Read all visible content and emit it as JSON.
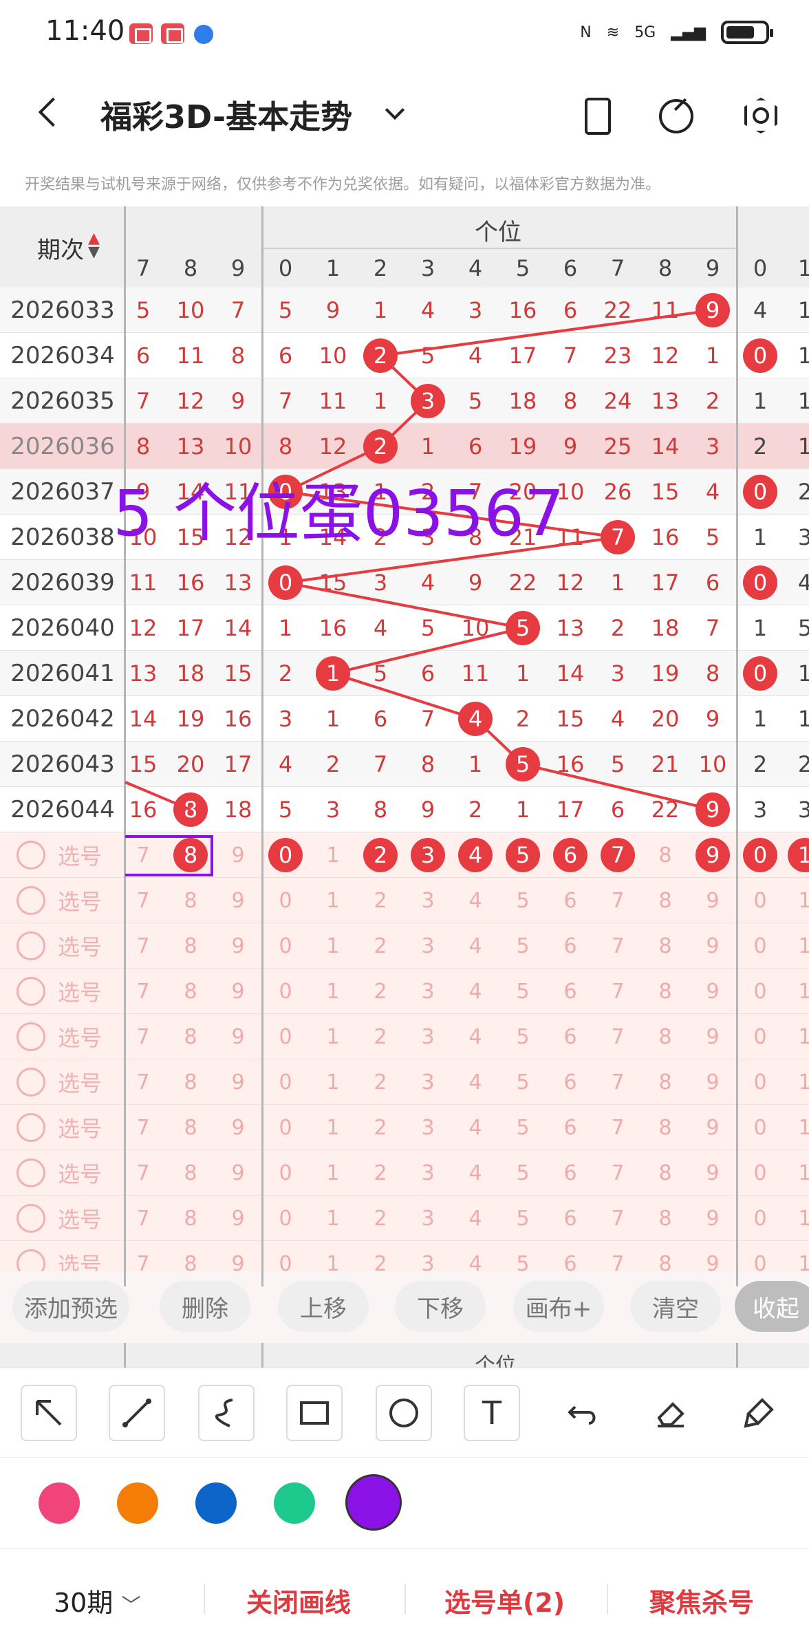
{
  "status_bar": {
    "time": "11:40",
    "net": "5G"
  },
  "header": {
    "title": "福彩3D-基本走势",
    "disclaimer": "开奖结果与试机号来源于网络，仅供参考不作为兑奖依据。如有疑问，以福体彩官方数据为准。"
  },
  "table": {
    "period_header": "期次",
    "group_label": "个位",
    "ten_cols": [
      "7",
      "8",
      "9"
    ],
    "unit_cols": [
      "0",
      "1",
      "2",
      "3",
      "4",
      "5",
      "6",
      "7",
      "8",
      "9"
    ],
    "next_cols": [
      "0",
      "1"
    ],
    "rows": [
      {
        "period": "2026033",
        "ten": [
          "5",
          "10",
          "7"
        ],
        "unit": [
          "5",
          "9",
          "1",
          "4",
          "3",
          "16",
          "6",
          "22",
          "11",
          "9"
        ],
        "hit": 9,
        "next": [
          "4",
          "1"
        ]
      },
      {
        "period": "2026034",
        "ten": [
          "6",
          "11",
          "8"
        ],
        "unit": [
          "6",
          "10",
          "2",
          "5",
          "4",
          "17",
          "7",
          "23",
          "12",
          "1"
        ],
        "hit": 2,
        "next": [
          "0",
          "1"
        ]
      },
      {
        "period": "2026035",
        "ten": [
          "7",
          "12",
          "9"
        ],
        "unit": [
          "7",
          "11",
          "1",
          "3",
          "5",
          "18",
          "8",
          "24",
          "13",
          "2"
        ],
        "hit": 3,
        "next": [
          "1",
          "1"
        ]
      },
      {
        "period": "2026036",
        "ten": [
          "8",
          "13",
          "10"
        ],
        "unit": [
          "8",
          "12",
          "2",
          "1",
          "6",
          "19",
          "9",
          "25",
          "14",
          "3"
        ],
        "hit": 2,
        "next": [
          "2",
          "1"
        ]
      },
      {
        "period": "2026037",
        "ten": [
          "9",
          "14",
          "11"
        ],
        "unit": [
          "0",
          "13",
          "1",
          "2",
          "7",
          "20",
          "10",
          "26",
          "15",
          "4"
        ],
        "hit": 0,
        "next": [
          "0",
          "2"
        ]
      },
      {
        "period": "2026038",
        "ten": [
          "10",
          "15",
          "12"
        ],
        "unit": [
          "1",
          "14",
          "2",
          "3",
          "8",
          "21",
          "11",
          "7",
          "16",
          "5"
        ],
        "hit": 7,
        "next": [
          "1",
          "3"
        ]
      },
      {
        "period": "2026039",
        "ten": [
          "11",
          "16",
          "13"
        ],
        "unit": [
          "0",
          "15",
          "3",
          "4",
          "9",
          "22",
          "12",
          "1",
          "17",
          "6"
        ],
        "hit": 0,
        "next": [
          "0",
          "4"
        ]
      },
      {
        "period": "2026040",
        "ten": [
          "12",
          "17",
          "14"
        ],
        "unit": [
          "1",
          "16",
          "4",
          "5",
          "10",
          "5",
          "13",
          "2",
          "18",
          "7"
        ],
        "hit": 5,
        "next": [
          "1",
          "5"
        ]
      },
      {
        "period": "2026041",
        "ten": [
          "13",
          "18",
          "15"
        ],
        "unit": [
          "2",
          "1",
          "5",
          "6",
          "11",
          "1",
          "14",
          "3",
          "19",
          "8"
        ],
        "hit": 1,
        "next": [
          "0",
          "1"
        ]
      },
      {
        "period": "2026042",
        "ten": [
          "14",
          "19",
          "16"
        ],
        "unit": [
          "3",
          "1",
          "6",
          "7",
          "4",
          "2",
          "15",
          "4",
          "20",
          "9"
        ],
        "hit": 4,
        "next": [
          "1",
          "1"
        ]
      },
      {
        "period": "2026043",
        "ten": [
          "15",
          "20",
          "17"
        ],
        "unit": [
          "4",
          "2",
          "7",
          "8",
          "1",
          "5",
          "16",
          "5",
          "21",
          "10"
        ],
        "hit": 5,
        "next": [
          "2",
          "2"
        ]
      },
      {
        "period": "2026044",
        "ten": [
          "16",
          "8",
          "18"
        ],
        "unit": [
          "5",
          "3",
          "8",
          "9",
          "2",
          "1",
          "17",
          "6",
          "22",
          "9"
        ],
        "hit": 9,
        "ten_hit": 1,
        "next": [
          "3",
          "3"
        ]
      }
    ],
    "select_label": "选号",
    "select_row_count": 10,
    "first_select_hits": [
      0,
      2,
      3,
      4,
      5,
      6,
      7,
      9
    ],
    "first_select_next": [
      "0",
      "1"
    ],
    "highlight_period": "2026036"
  },
  "annotation_text": "5 个位蛋03567",
  "actions": [
    "添加预选",
    "删除",
    "上移",
    "下移",
    "画布+",
    "清空",
    "收起"
  ],
  "tools": [
    "arrow-icon",
    "line-icon",
    "curve-icon",
    "rectangle-icon",
    "circle-icon",
    "text-icon",
    "undo-icon",
    "eraser-icon",
    "clear-icon"
  ],
  "tool_text_label": "T",
  "colors": [
    "#f0447a",
    "#f57c06",
    "#0d65c9",
    "#1ec98e",
    "#8b12e6"
  ],
  "selected_color": "#8b12e6",
  "bottom": {
    "periods": "30期",
    "close_line": "关闭画线",
    "select_list": "选号单(2)",
    "focus_kill": "聚焦杀号"
  },
  "partial_header_group": "个位"
}
